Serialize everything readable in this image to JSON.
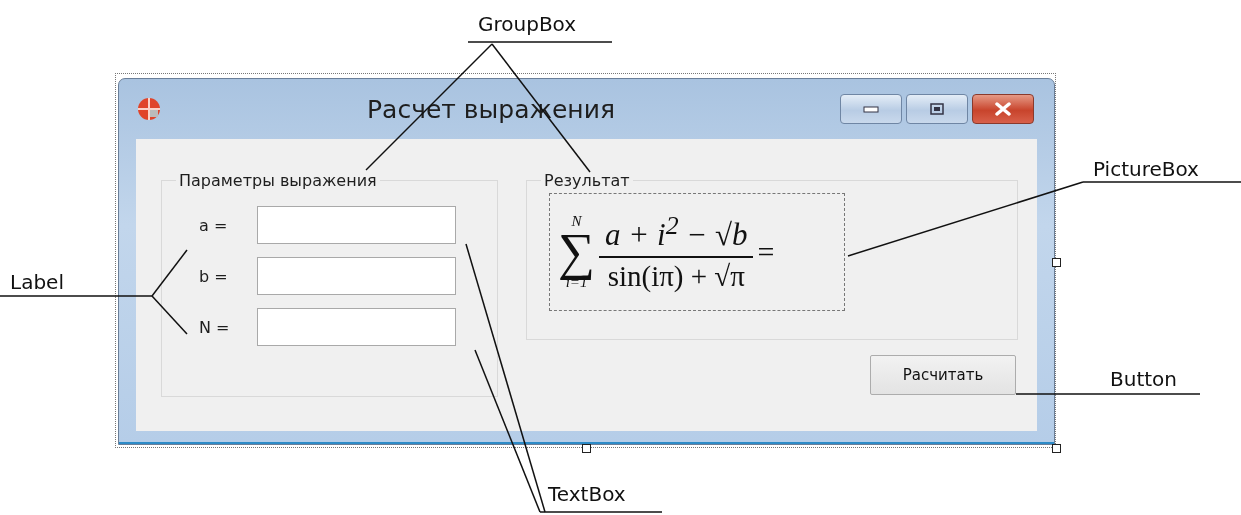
{
  "window": {
    "title": "Расчет выражения",
    "controls": [
      {
        "kind": "minimize"
      },
      {
        "kind": "maximize"
      },
      {
        "kind": "close"
      }
    ]
  },
  "parameters_group": {
    "title": "Параметры выражения",
    "fields": [
      {
        "label": "a ="
      },
      {
        "label": "b ="
      },
      {
        "label": "N ="
      }
    ]
  },
  "result_group": {
    "title": "Результат",
    "formula": {
      "sum_symbol": "∑",
      "sum_upper": "N",
      "sum_lower": "i=1",
      "numerator": "a + i$^{2}$ − √b",
      "denominator": "sin(iπ) + √π",
      "equals": "="
    }
  },
  "button": {
    "label": "Расчитать"
  },
  "callouts": [
    {
      "text": "GroupBox"
    },
    {
      "text": "Label"
    },
    {
      "text": "PictureBox"
    },
    {
      "text": "Button"
    },
    {
      "text": "TextBox"
    }
  ]
}
